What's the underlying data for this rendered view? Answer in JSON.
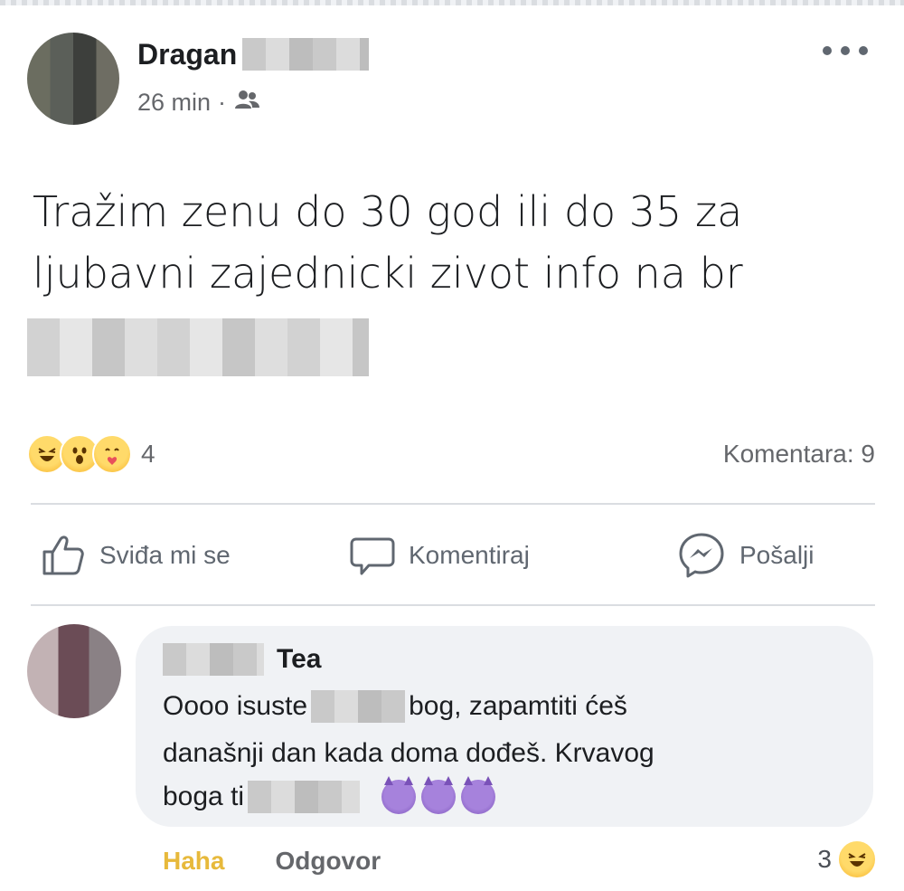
{
  "post": {
    "author": "Dragan",
    "time": "26 min",
    "separator": "·",
    "audience_icon": "friends-icon",
    "text": "Tražim zenu do 30 god ili do 35 za ljubavni zajednicki zivot info na br",
    "reaction_icons": [
      "haha",
      "wow",
      "care"
    ],
    "reaction_count": "4",
    "comments_label": "Komentara: 9"
  },
  "actions": {
    "like_label": "Sviđa mi se",
    "comment_label": "Komentiraj",
    "send_label": "Pošalji"
  },
  "comment": {
    "author": "Tea",
    "line1_start": "Oooo isuste",
    "line1_end": "bog, zapamtiti ćeš",
    "line2": "današnji dan kada doma dođeš. Krvavog",
    "line3_start": "boga ti",
    "emoji": [
      "devil",
      "devil",
      "devil"
    ],
    "haha_label": "Haha",
    "reply_label": "Odgovor",
    "reaction_count": "3",
    "reaction_icon": "haha"
  },
  "colors": {
    "text_primary": "#1c1e21",
    "text_secondary": "#65676b",
    "bubble_bg": "#f0f2f5",
    "haha_yellow": "#e7b93b"
  }
}
